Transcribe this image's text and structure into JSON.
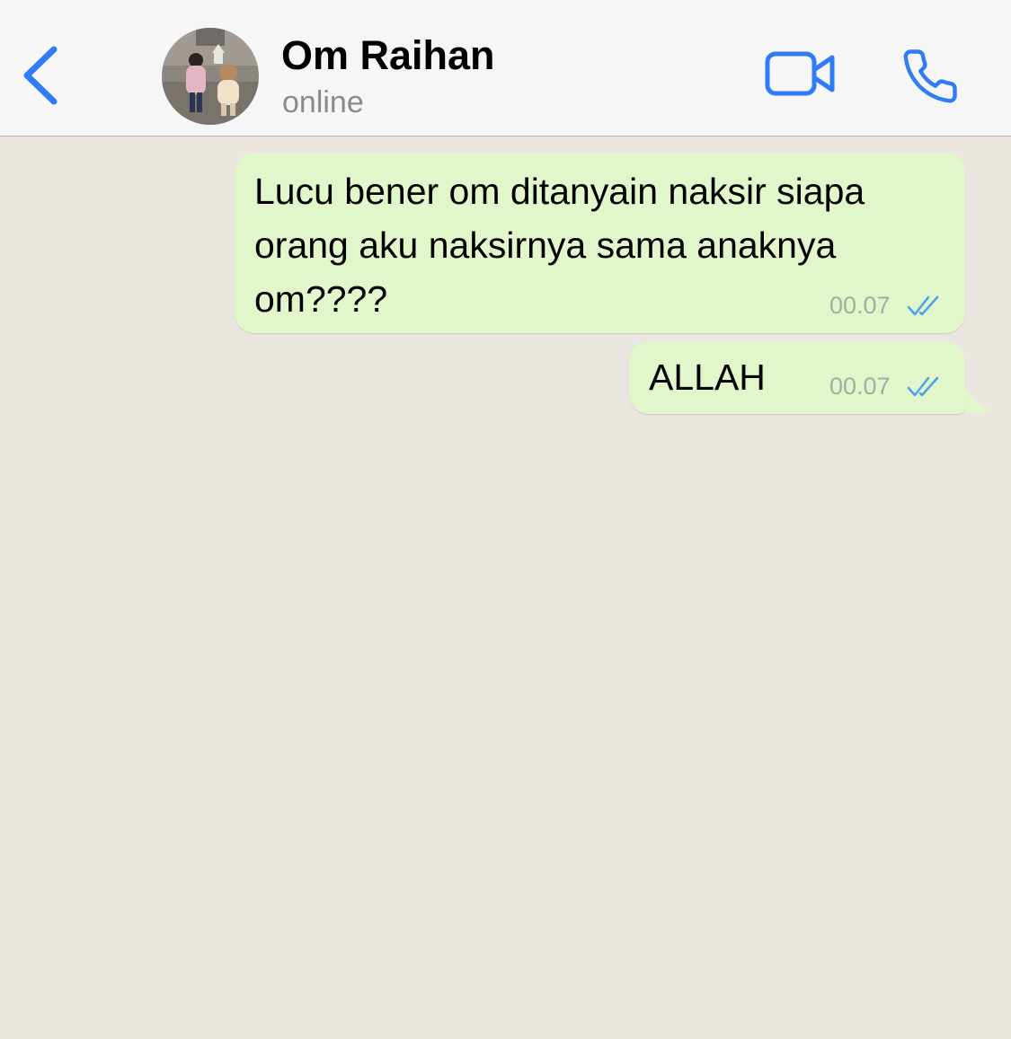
{
  "header": {
    "back_icon": "chevron-left-icon",
    "contact_name": "Om Raihan",
    "contact_status": "online",
    "video_icon": "video-camera-icon",
    "call_icon": "phone-icon",
    "accent_color": "#2f7cf6"
  },
  "messages": [
    {
      "text": "Lucu bener om ditanyain naksir siapa orang aku naksirnya sama anaknya om????",
      "time": "00.07",
      "status_icon": "double-check-icon",
      "direction": "outgoing"
    },
    {
      "text": "ALLAH",
      "time": "00.07",
      "status_icon": "double-check-icon",
      "direction": "outgoing"
    }
  ],
  "colors": {
    "chat_background": "#eae6df",
    "outgoing_bubble": "#e1f7cb",
    "header_background": "#f6f6f6",
    "read_check": "#4fa3e8"
  }
}
